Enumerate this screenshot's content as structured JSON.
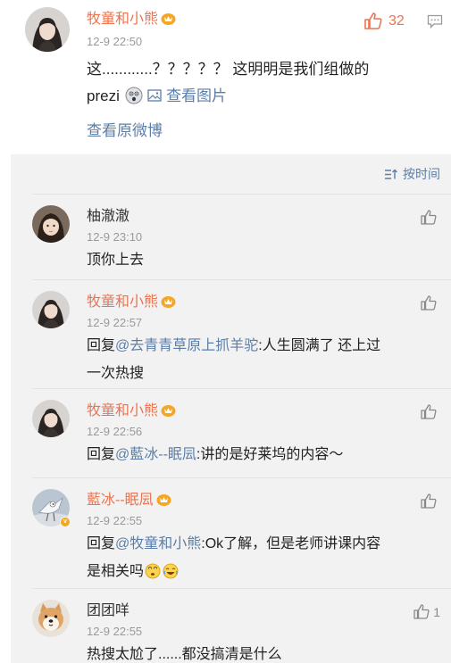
{
  "post": {
    "author": "牧童和小熊",
    "time": "12-9 22:50",
    "text_1": "这............？？？？？ 这明明是我们组做的",
    "text_2": "prezi",
    "view_image": "查看图片",
    "likes": "32",
    "view_original": "查看原微博"
  },
  "replies_header": {
    "sort_label": "按时间"
  },
  "replies": [
    {
      "author": "柚澈澈",
      "time": "12-9 23:10",
      "text": "顶你上去",
      "likes": ""
    },
    {
      "author": "牧童和小熊",
      "time": "12-9 22:57",
      "prefix": "回复",
      "mention": "@去青青草原上抓羊驼",
      "text": ":人生圆满了 还上过",
      "text_2": "一次热搜",
      "likes": ""
    },
    {
      "author": "牧童和小熊",
      "time": "12-9 22:56",
      "prefix": "回复",
      "mention": "@藍冰--眠凨",
      "text": ":讲的是好莱坞的内容～",
      "likes": ""
    },
    {
      "author": "藍冰--眠凨",
      "time": "12-9 22:55",
      "prefix": "回复",
      "mention": "@牧童和小熊",
      "text": ":Ok了解，但是老师讲课内容",
      "text_2": "是相关吗",
      "likes": ""
    },
    {
      "author": "团团咩",
      "time": "12-9 22:55",
      "text": "热搜太尬了......都没搞清是什么",
      "likes": "1"
    }
  ],
  "colors": {
    "accent": "#eb7350",
    "link": "#5b7ea8",
    "panel_bg": "#f2f2f2",
    "meta": "#9a9a9a"
  }
}
